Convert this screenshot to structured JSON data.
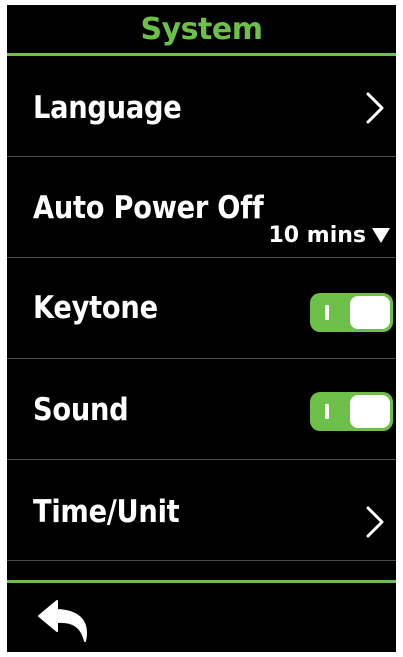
{
  "header": {
    "title": "System"
  },
  "menu": {
    "language": {
      "label": "Language",
      "icon": "chevron-right-icon"
    },
    "auto_power_off": {
      "label": "Auto Power Off",
      "value": "10 mins",
      "icon": "triangle-down-icon"
    },
    "keytone": {
      "label": "Keytone",
      "state": "on"
    },
    "sound": {
      "label": "Sound",
      "state": "on"
    },
    "time_unit": {
      "label": "Time/Unit",
      "icon": "chevron-right-icon"
    }
  },
  "footer": {
    "back_icon": "back-arrow-icon"
  },
  "colors": {
    "accent": "#6cc04a",
    "background": "#000000",
    "text": "#ffffff",
    "divider": "#4a4a4a"
  }
}
